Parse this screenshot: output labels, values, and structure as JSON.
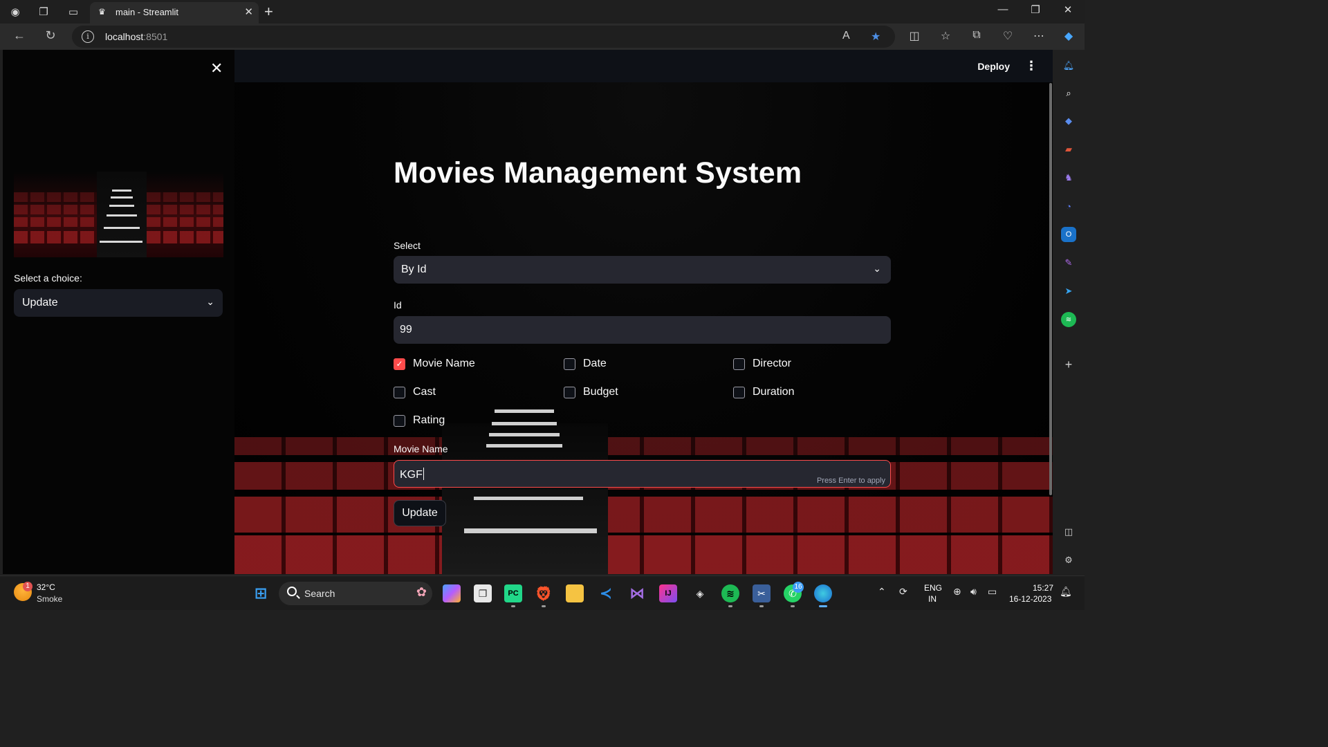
{
  "browser": {
    "tab_title": "main - Streamlit",
    "url_host": "localhost",
    "url_port": ":8501"
  },
  "sidebar": {
    "choice_label": "Select a choice:",
    "choice_value": "Update"
  },
  "header": {
    "deploy_label": "Deploy"
  },
  "main": {
    "title": "Movies Management System",
    "select_label": "Select",
    "select_value": "By Id",
    "id_label": "Id",
    "id_value": "99",
    "checkboxes": [
      {
        "label": "Movie Name",
        "checked": true
      },
      {
        "label": "Date",
        "checked": false
      },
      {
        "label": "Director",
        "checked": false
      },
      {
        "label": "Cast",
        "checked": false
      },
      {
        "label": "Budget",
        "checked": false
      },
      {
        "label": "Duration",
        "checked": false
      },
      {
        "label": "Rating",
        "checked": false
      }
    ],
    "movie_name_label": "Movie Name",
    "movie_name_value": "KGF",
    "enter_hint": "Press Enter to apply",
    "update_button": "Update"
  },
  "taskbar": {
    "weather_badge": "1",
    "temperature": "32°C",
    "condition": "Smoke",
    "search_label": "Search",
    "whatsapp_badge": "16",
    "lang_top": "ENG",
    "lang_bottom": "IN",
    "time": "15:27",
    "date": "16-12-2023"
  },
  "colors": {
    "accent": "#ff4b4b",
    "input_bg": "#262730",
    "app_bg": "#0e1117"
  }
}
